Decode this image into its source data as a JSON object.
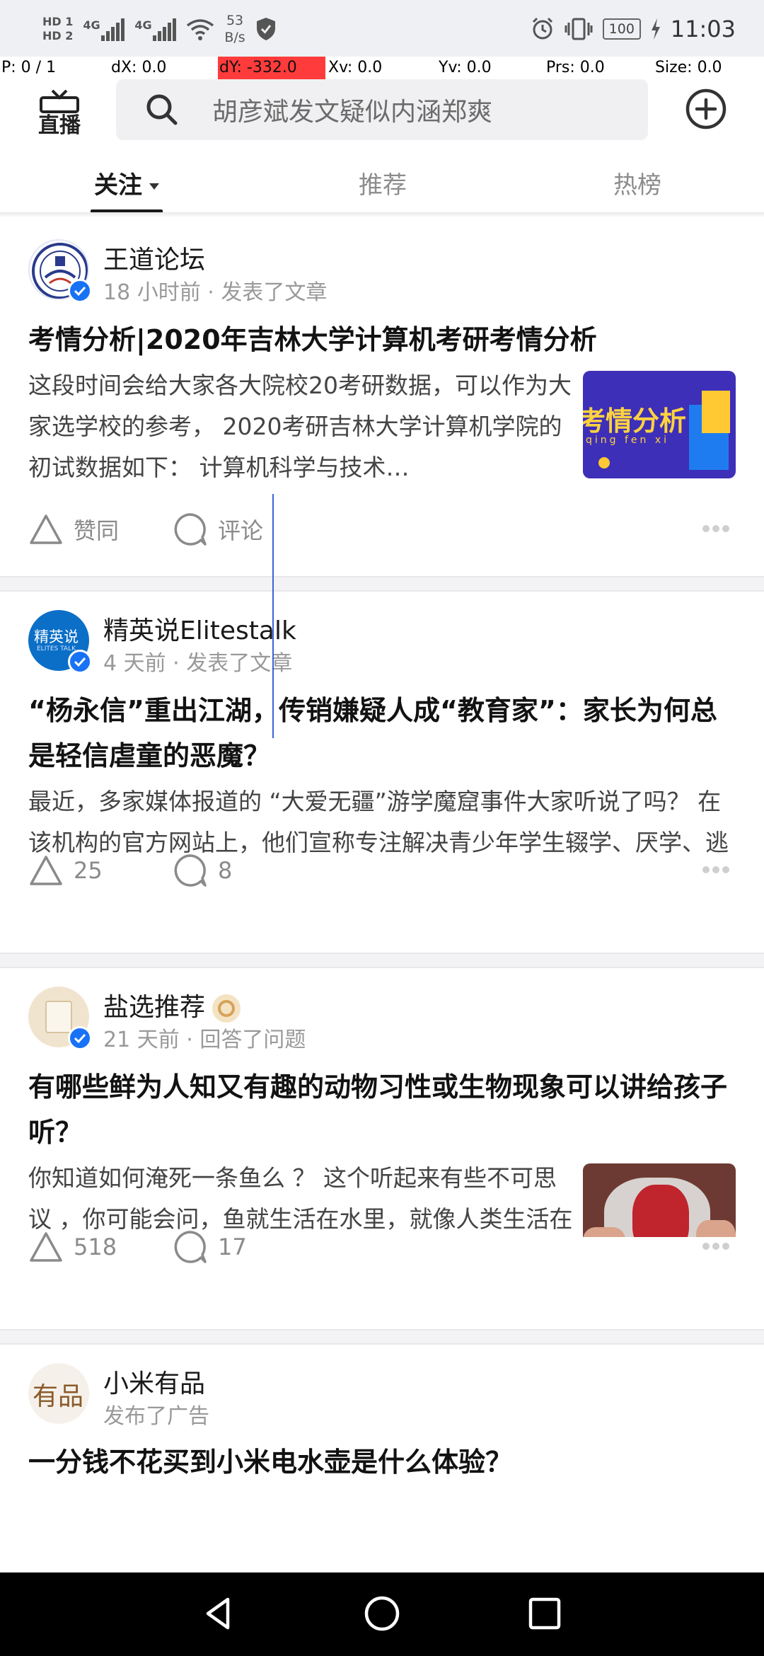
{
  "status_bar": {
    "hd1": "HD 1",
    "hd2": "HD 2",
    "sim1": "4G",
    "sim2": "4G",
    "net_speed_value": "53",
    "net_speed_unit": "B/s",
    "battery": "100",
    "time": "11:03"
  },
  "debug_overlay": {
    "p": "P: 0 / 1",
    "dx": "dX: 0.0",
    "dy": "dY: -332.0",
    "xv": "Xv: 0.0",
    "yv": "Yv: 0.0",
    "prs": "Prs: 0.0",
    "size": "Size: 0.0",
    "highlight_color": "#ff3b3b"
  },
  "header": {
    "live_label": "直播",
    "search_placeholder": "胡彦斌发文疑似内涵郑爽",
    "tabs": [
      {
        "label": "关注",
        "active": true
      },
      {
        "label": "推荐",
        "active": false
      },
      {
        "label": "热榜",
        "active": false
      }
    ]
  },
  "feed": [
    {
      "author": "王道论坛",
      "meta": "18 小时前 · 发表了文章",
      "title": "考情分析|2020年吉林大学计算机考研考情分析",
      "excerpt": "这段时间会给大家各大院校20考研数据，可以作为大家选学校的参考， 2020考研吉林大学计算机学院的初试数据如下： 计算机科学与技术…",
      "thumb_text": "考情分析",
      "thumb_sub": "qing fen xi",
      "like_label": "赞同",
      "comment_label": "评论"
    },
    {
      "author": "精英说Elitestalk",
      "avatar_text": "精英说",
      "avatar_sub": "ELITES TALK",
      "meta": "4 天前 · 发表了文章",
      "title": "“杨永信”重出江湖，传销嫌疑人成“教育家”：家长为何总是轻信虐童的恶魔？",
      "excerpt": "最近，多家媒体报道的 “大爱无疆”游学魔窟事件大家听说了吗？ 在该机构的官方网站上，他们宣称专注解决青少年学生辍学、厌学、逃学、拖拉、网瘾、抑郁等问题，在全国已经有…",
      "like_label": "25",
      "comment_label": "8"
    },
    {
      "author": "盐选推荐",
      "meta": "21 天前 · 回答了问题",
      "title": "有哪些鲜为人知又有趣的动物习性或生物现象可以讲给孩子听？",
      "excerpt": "你知道如何淹死一条鱼么 ？ 这个听起来有些不可思议 ，你可能会问，鱼就生活在水里，就像人类生活在空气中那么自然，那在水里淹死…",
      "like_label": "518",
      "comment_label": "17"
    },
    {
      "author": "小米有品",
      "avatar_text": "有品",
      "meta": "发布了广告",
      "title": "一分钱不花买到小米电水壶是什么体验？"
    }
  ],
  "colors": {
    "accent_blue": "#1772f6",
    "text_primary": "#1a1a1a",
    "text_secondary": "#999999"
  },
  "icons": [
    "live-tv-icon",
    "search-icon",
    "add-circle-icon",
    "verified-icon",
    "upvote-icon",
    "comment-icon",
    "more-icon",
    "back-icon",
    "home-icon",
    "recents-icon"
  ]
}
